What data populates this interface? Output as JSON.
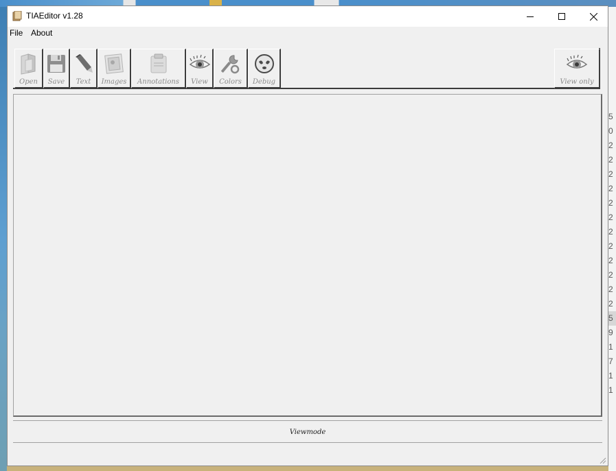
{
  "window": {
    "title": "TIAEditor v1.28"
  },
  "menu": {
    "items": [
      {
        "label": "File"
      },
      {
        "label": "About"
      }
    ]
  },
  "toolbar": {
    "buttons": [
      {
        "label": "Open",
        "icon": "folder-icon"
      },
      {
        "label": "Save",
        "icon": "floppy-disk-icon"
      },
      {
        "label": "Text",
        "icon": "pencil-icon"
      },
      {
        "label": "Images",
        "icon": "image-frame-icon"
      },
      {
        "label": "Annotations",
        "icon": "note-icon"
      },
      {
        "label": "View",
        "icon": "eye-icon"
      },
      {
        "label": "Colors",
        "icon": "wrench-icon"
      },
      {
        "label": "Debug",
        "icon": "bug-icon"
      }
    ],
    "right_button": {
      "label": "View only",
      "icon": "eye-icon"
    }
  },
  "status": {
    "mode": "Viewmode"
  },
  "background_window": {
    "visible_digits": [
      "5",
      "0",
      "2",
      "2",
      "2",
      "2",
      "2",
      "2",
      "2",
      "2",
      "2",
      "2",
      "2",
      "2",
      "5",
      "9",
      "1",
      "7",
      "1",
      "1"
    ]
  },
  "colors": {
    "window_bg": "#f0f0f0",
    "titlebar_bg": "#ffffff",
    "button_label": "#8a8a8a"
  }
}
